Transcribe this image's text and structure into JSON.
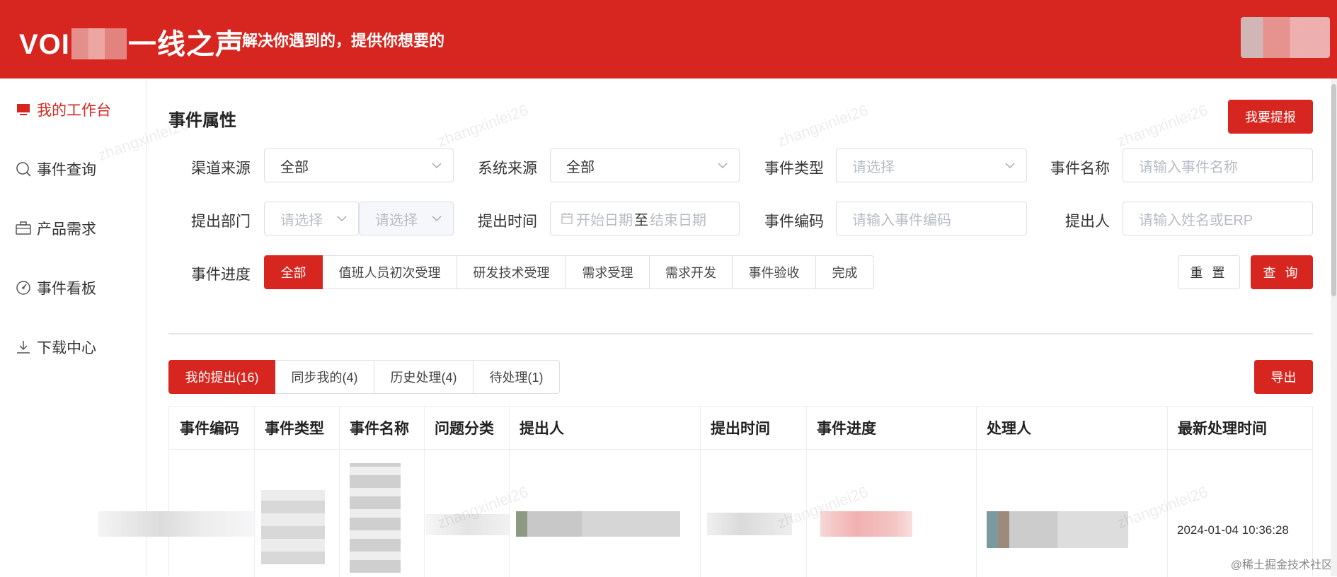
{
  "header": {
    "logo_prefix": "VOI",
    "logo_suffix": "一线之声",
    "slogan": "解决你遇到的，提供你想要的"
  },
  "sidebar": {
    "items": [
      {
        "label": "我的工作台",
        "icon": "monitor-icon",
        "active": true
      },
      {
        "label": "事件查询",
        "icon": "search-icon",
        "active": false
      },
      {
        "label": "产品需求",
        "icon": "briefcase-icon",
        "active": false
      },
      {
        "label": "事件看板",
        "icon": "dashboard-icon",
        "active": false
      },
      {
        "label": "下载中心",
        "icon": "download-icon",
        "active": false
      }
    ]
  },
  "main": {
    "section_title": "事件属性",
    "submit_button": "我要提报",
    "filters": {
      "channel_source": {
        "label": "渠道来源",
        "value": "全部"
      },
      "system_source": {
        "label": "系统来源",
        "value": "全部"
      },
      "event_type": {
        "label": "事件类型",
        "placeholder": "请选择"
      },
      "event_name": {
        "label": "事件名称",
        "placeholder": "请输入事件名称"
      },
      "dept": {
        "label": "提出部门",
        "placeholder1": "请选择",
        "placeholder2": "请选择"
      },
      "submit_time": {
        "label": "提出时间",
        "start_placeholder": "开始日期",
        "separator": "至",
        "end_placeholder": "结束日期"
      },
      "event_code": {
        "label": "事件编码",
        "placeholder": "请输入事件编码"
      },
      "submitter": {
        "label": "提出人",
        "placeholder": "请输入姓名或ERP"
      },
      "progress": {
        "label": "事件进度",
        "options": [
          "全部",
          "值班人员初次受理",
          "研发技术受理",
          "需求受理",
          "需求开发",
          "事件验收",
          "完成"
        ],
        "selected": "全部"
      }
    },
    "reset_button": "重 置",
    "query_button": "查 询",
    "tabs": [
      {
        "label": "我的提出(16)",
        "active": true
      },
      {
        "label": "同步我的(4)",
        "active": false
      },
      {
        "label": "历史处理(4)",
        "active": false
      },
      {
        "label": "待处理(1)",
        "active": false
      }
    ],
    "export_button": "导出",
    "table": {
      "headers": [
        "事件编码",
        "事件类型",
        "事件名称",
        "问题分类",
        "提出人",
        "提出时间",
        "事件进度",
        "处理人",
        "最新处理时间"
      ],
      "rows": [
        {
          "latest_time": "2024-01-04 10:36:28"
        }
      ]
    }
  },
  "watermark_text": "zhangxinlei26",
  "corner_credit": "@稀土掘金技术社区",
  "colors": {
    "brand_red": "#d7261f",
    "border": "#dcdfe6",
    "placeholder": "#b8bcc4"
  }
}
